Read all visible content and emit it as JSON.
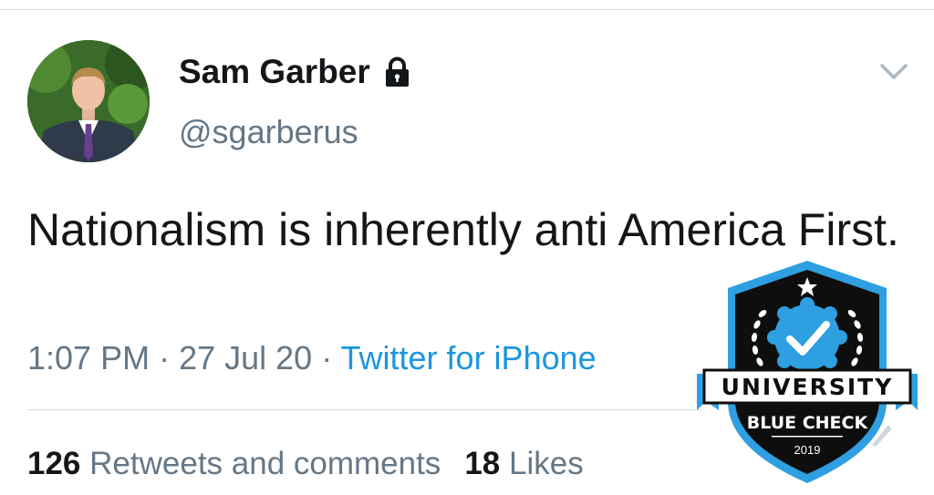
{
  "user": {
    "display_name": "Sam Garber",
    "handle": "@sgarberus",
    "protected_icon": "lock-icon",
    "avatar_icon": "profile-photo"
  },
  "menu": {
    "icon": "chevron-down-icon"
  },
  "tweet": {
    "text": "Nationalism is inherently anti America First.",
    "time": "1:07 PM",
    "separator": " · ",
    "date": "27 Jul 20",
    "source": "Twitter for iPhone"
  },
  "stats": {
    "retweets_count": "126",
    "retweets_label": "Retweets and comments",
    "likes_count": "18",
    "likes_label": "Likes"
  },
  "badge": {
    "line1": "UNIVERSITY",
    "line2": "BLUE CHECK",
    "year": "2019"
  },
  "colors": {
    "link": "#1b95e0",
    "muted": "#657786",
    "badge_blue": "#2e9fe0"
  }
}
